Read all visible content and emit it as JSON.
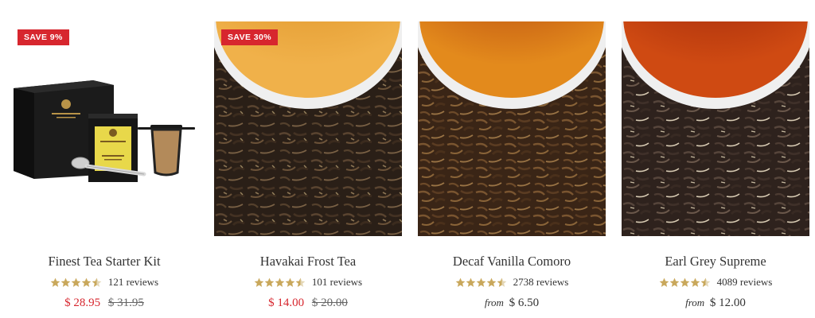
{
  "colors": {
    "sale_red": "#d7262e",
    "star_gold": "#c9a85c",
    "text": "#333333"
  },
  "products": [
    {
      "name": "Finest Tea Starter Kit",
      "badge": "SAVE 9%",
      "rating": 4.5,
      "reviews": "121 reviews",
      "price": "$ 28.95",
      "compare_price": "$ 31.95",
      "image": "starter-kit-image"
    },
    {
      "name": "Havakai Frost Tea",
      "badge": "SAVE 30%",
      "rating": 4.5,
      "reviews": "101 reviews",
      "price": "$ 14.00",
      "compare_price": "$ 20.00",
      "image": "loose-leaf-tea-image"
    },
    {
      "name": "Decaf Vanilla Comoro",
      "badge": "",
      "rating": 4.5,
      "reviews": "2738 reviews",
      "price_prefix": "from",
      "price": "$ 6.50",
      "image": "loose-leaf-tea-image"
    },
    {
      "name": "Earl Grey Supreme",
      "badge": "",
      "rating": 4.5,
      "reviews": "4089 reviews",
      "price_prefix": "from",
      "price": "$ 12.00",
      "image": "loose-leaf-tea-image"
    }
  ]
}
